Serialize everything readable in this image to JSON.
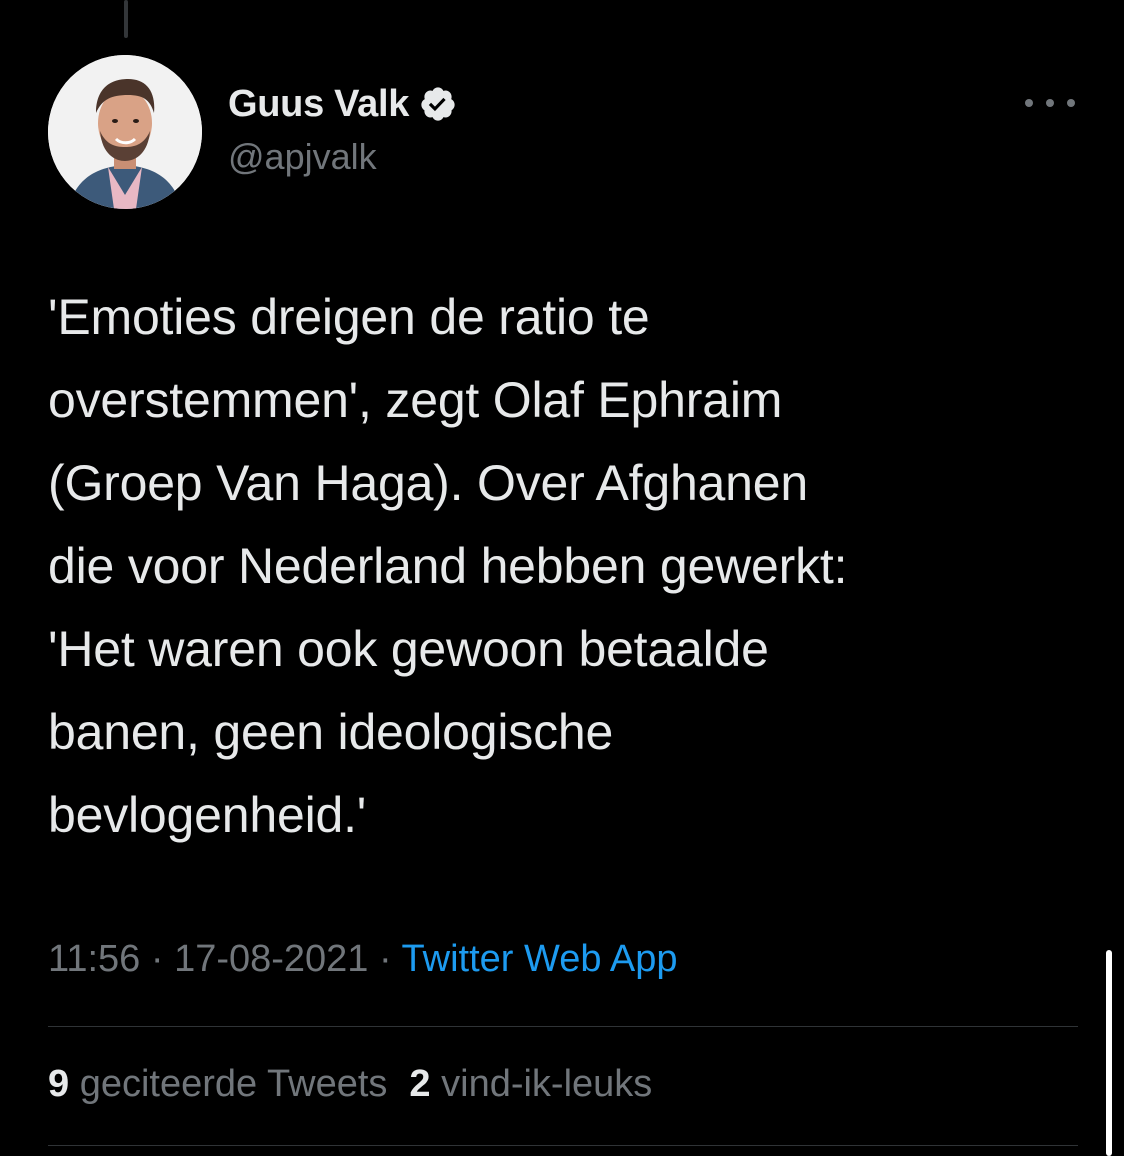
{
  "author": {
    "display_name": "Guus Valk",
    "handle": "@apjvalk",
    "verified": true
  },
  "tweet": {
    "text": "'Emoties dreigen de ratio te\noverstemmen', zegt Olaf Ephraim\n(Groep Van Haga). Over Afghanen\ndie voor Nederland hebben gewerkt:\n'Het waren ook gewoon betaalde\nbanen, geen ideologische\nbevlogenheid.'",
    "time": "11:56",
    "date": "17-08-2021",
    "separator": " · ",
    "source": "Twitter Web App"
  },
  "stats": {
    "quotes_count": "9",
    "quotes_label": "geciteerde Tweets",
    "likes_count": "2",
    "likes_label": "vind-ik-leuks"
  },
  "icons": {
    "verified": "verified-badge-icon",
    "more": "more-options-icon"
  },
  "colors": {
    "background": "#000000",
    "text": "#e7e9ea",
    "secondary": "#71767b",
    "link": "#1d9bf0",
    "divider": "#2f3336"
  }
}
